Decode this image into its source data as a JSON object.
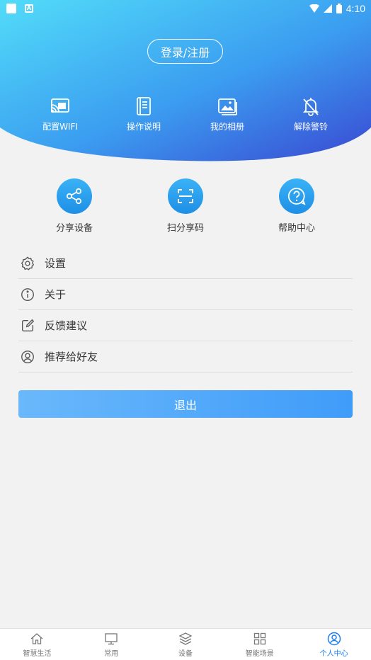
{
  "status_bar": {
    "time": "4:10"
  },
  "header": {
    "login_label": "登录/注册",
    "quick_actions": [
      {
        "label": "配置WIFI",
        "icon": "cast-wifi-icon"
      },
      {
        "label": "操作说明",
        "icon": "manual-book-icon"
      },
      {
        "label": "我的相册",
        "icon": "photo-album-icon"
      },
      {
        "label": "解除警铃",
        "icon": "bell-off-icon"
      }
    ]
  },
  "features": [
    {
      "label": "分享设备",
      "icon": "share-icon"
    },
    {
      "label": "扫分享码",
      "icon": "scan-icon"
    },
    {
      "label": "帮助中心",
      "icon": "help-icon"
    }
  ],
  "menu": [
    {
      "label": "设置",
      "icon": "gear-icon"
    },
    {
      "label": "关于",
      "icon": "info-icon"
    },
    {
      "label": "反馈建议",
      "icon": "edit-icon"
    },
    {
      "label": "推荐给好友",
      "icon": "user-circle-icon"
    }
  ],
  "logout_label": "退出",
  "bottom_nav": [
    {
      "label": "智慧生活",
      "icon": "home-icon",
      "active": false
    },
    {
      "label": "常用",
      "icon": "monitor-icon",
      "active": false
    },
    {
      "label": "设备",
      "icon": "layers-icon",
      "active": false
    },
    {
      "label": "智能场景",
      "icon": "grid-icon",
      "active": false
    },
    {
      "label": "个人中心",
      "icon": "person-icon",
      "active": true
    }
  ],
  "colors": {
    "accent": "#1a7ef0",
    "header_start": "#4fd8f8",
    "header_end": "#3a4fd6"
  }
}
